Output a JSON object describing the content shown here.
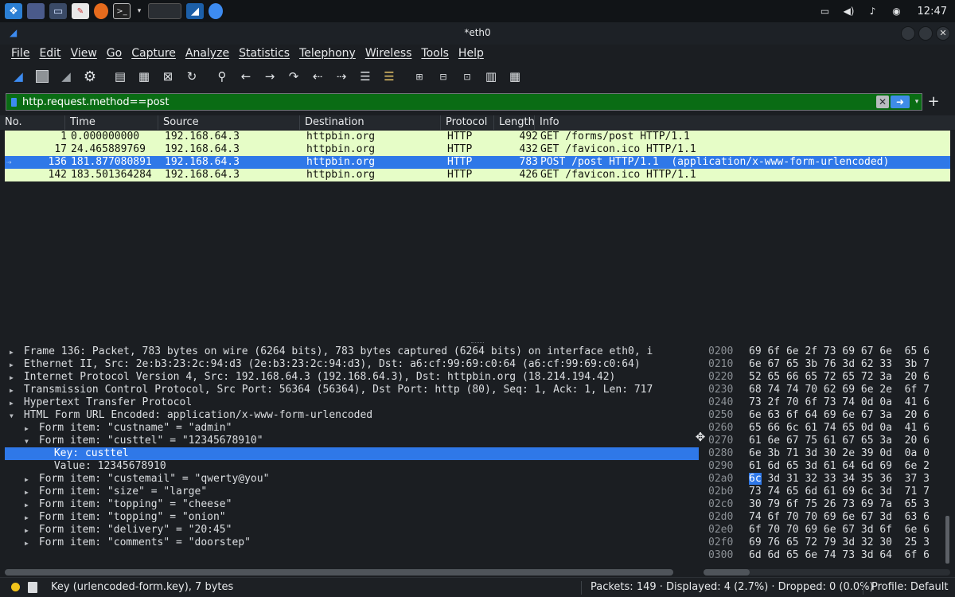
{
  "system": {
    "clock": "12:47",
    "colors": {
      "accent": "#2f78e8",
      "filter_ok": "#0a6c14",
      "http_row": "#e6fdc7",
      "status_dot": "#f2c31b"
    }
  },
  "window": {
    "title": "*eth0"
  },
  "menu": [
    "File",
    "Edit",
    "View",
    "Go",
    "Capture",
    "Analyze",
    "Statistics",
    "Telephony",
    "Wireless",
    "Tools",
    "Help"
  ],
  "filter": {
    "value": "http.request.method==post"
  },
  "packet_list": {
    "columns": [
      "No.",
      "Time",
      "Source",
      "Destination",
      "Protocol",
      "Length",
      "Info"
    ],
    "rows": [
      {
        "no": "1",
        "time": "0.000000000",
        "src": "192.168.64.3",
        "dst": "httpbin.org",
        "proto": "HTTP",
        "len": "492",
        "info": "GET /forms/post HTTP/1.1"
      },
      {
        "no": "17",
        "time": "24.465889769",
        "src": "192.168.64.3",
        "dst": "httpbin.org",
        "proto": "HTTP",
        "len": "432",
        "info": "GET /favicon.ico HTTP/1.1"
      },
      {
        "no": "136",
        "time": "181.877080891",
        "src": "192.168.64.3",
        "dst": "httpbin.org",
        "proto": "HTTP",
        "len": "783",
        "info": "POST /post HTTP/1.1  (application/x-www-form-urlencoded)"
      },
      {
        "no": "142",
        "time": "183.501364284",
        "src": "192.168.64.3",
        "dst": "httpbin.org",
        "proto": "HTTP",
        "len": "426",
        "info": "GET /favicon.ico HTTP/1.1"
      }
    ]
  },
  "details": [
    {
      "indent": 0,
      "twisty": "collapsed",
      "text": "Frame 136: Packet, 783 bytes on wire (6264 bits), 783 bytes captured (6264 bits) on interface eth0, i"
    },
    {
      "indent": 0,
      "twisty": "collapsed",
      "text": "Ethernet II, Src: 2e:b3:23:2c:94:d3 (2e:b3:23:2c:94:d3), Dst: a6:cf:99:69:c0:64 (a6:cf:99:69:c0:64)"
    },
    {
      "indent": 0,
      "twisty": "collapsed",
      "text": "Internet Protocol Version 4, Src: 192.168.64.3 (192.168.64.3), Dst: httpbin.org (18.214.194.42)"
    },
    {
      "indent": 0,
      "twisty": "collapsed",
      "text": "Transmission Control Protocol, Src Port: 56364 (56364), Dst Port: http (80), Seq: 1, Ack: 1, Len: 717"
    },
    {
      "indent": 0,
      "twisty": "collapsed",
      "text": "Hypertext Transfer Protocol"
    },
    {
      "indent": 0,
      "twisty": "expanded",
      "text": "HTML Form URL Encoded: application/x-www-form-urlencoded"
    },
    {
      "indent": 1,
      "twisty": "collapsed",
      "text": "Form item: \"custname\" = \"admin\""
    },
    {
      "indent": 1,
      "twisty": "expanded",
      "text": "Form item: \"custtel\" = \"12345678910\""
    },
    {
      "indent": 2,
      "twisty": "none",
      "text": "Key: custtel"
    },
    {
      "indent": 2,
      "twisty": "none",
      "text": "Value: 12345678910"
    },
    {
      "indent": 1,
      "twisty": "collapsed",
      "text": "Form item: \"custemail\" = \"qwerty@you\""
    },
    {
      "indent": 1,
      "twisty": "collapsed",
      "text": "Form item: \"size\" = \"large\""
    },
    {
      "indent": 1,
      "twisty": "collapsed",
      "text": "Form item: \"topping\" = \"cheese\""
    },
    {
      "indent": 1,
      "twisty": "collapsed",
      "text": "Form item: \"topping\" = \"onion\""
    },
    {
      "indent": 1,
      "twisty": "collapsed",
      "text": "Form item: \"delivery\" = \"20:45\""
    },
    {
      "indent": 1,
      "twisty": "collapsed",
      "text": "Form item: \"comments\" = \"doorstep\""
    }
  ],
  "hex": [
    {
      "offset": "0200",
      "bytes": "69 6f 6e 2f 73 69 67 6e  65 6"
    },
    {
      "offset": "0210",
      "bytes": "6e 67 65 3b 76 3d 62 33  3b 7"
    },
    {
      "offset": "0220",
      "bytes": "52 65 66 65 72 65 72 3a  20 6"
    },
    {
      "offset": "0230",
      "bytes": "68 74 74 70 62 69 6e 2e  6f 7"
    },
    {
      "offset": "0240",
      "bytes": "73 2f 70 6f 73 74 0d 0a  41 6"
    },
    {
      "offset": "0250",
      "bytes": "6e 63 6f 64 69 6e 67 3a  20 6"
    },
    {
      "offset": "0260",
      "bytes": "65 66 6c 61 74 65 0d 0a  41 6"
    },
    {
      "offset": "0270",
      "bytes": "61 6e 67 75 61 67 65 3a  20 6"
    },
    {
      "offset": "0280",
      "bytes": "6e 3b 71 3d 30 2e 39 0d  0a 0"
    },
    {
      "offset": "0290",
      "bytes": "61 6d 65 3d 61 64 6d 69  6e 2"
    },
    {
      "offset": "02a0",
      "hl": "6c",
      "bytes": " 3d 31 32 33 34 35 36  37 3"
    },
    {
      "offset": "02b0",
      "bytes": "73 74 65 6d 61 69 6c 3d  71 7"
    },
    {
      "offset": "02c0",
      "bytes": "30 79 6f 75 26 73 69 7a  65 3"
    },
    {
      "offset": "02d0",
      "bytes": "74 6f 70 70 69 6e 67 3d  63 6"
    },
    {
      "offset": "02e0",
      "bytes": "6f 70 70 69 6e 67 3d 6f  6e 6"
    },
    {
      "offset": "02f0",
      "bytes": "69 76 65 72 79 3d 32 30  25 3"
    },
    {
      "offset": "0300",
      "bytes": "6d 6d 65 6e 74 73 3d 64  6f 6"
    }
  ],
  "status": {
    "field": "Key (urlencoded-form.key), 7 bytes",
    "packets": "Packets: 149 · Displayed: 4 (2.7%) · Dropped: 0 (0.0%)",
    "profile": "Profile: Default"
  }
}
